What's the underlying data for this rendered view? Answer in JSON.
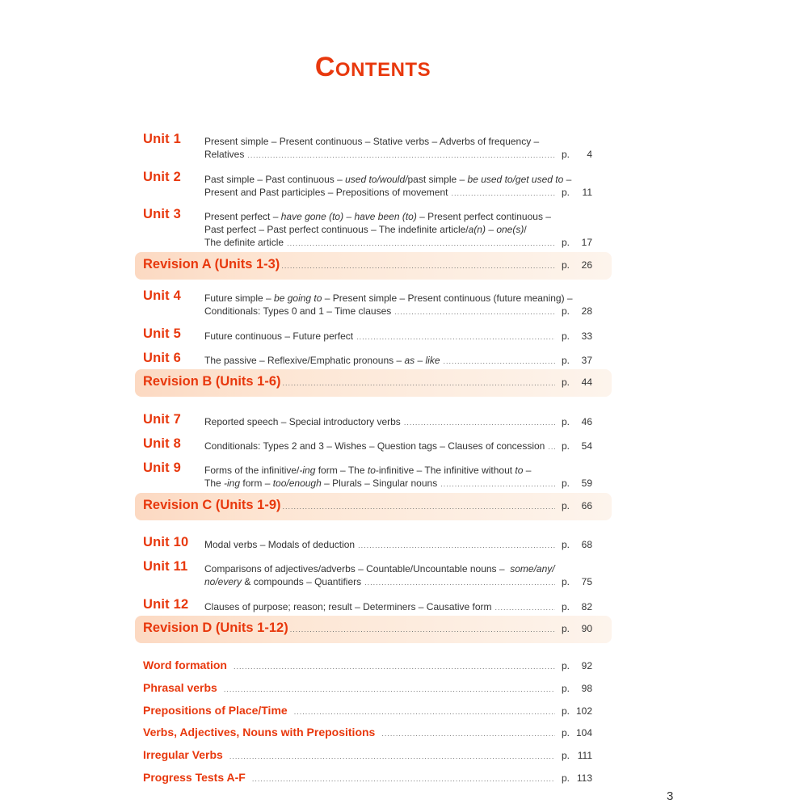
{
  "title": "Contents",
  "page_prefix": "p.",
  "units": [
    {
      "label": "Unit 1",
      "lines": [
        "Present simple – Present continuous – Stative verbs – Adverbs of frequency –",
        "Relatives"
      ],
      "page": "4"
    },
    {
      "label": "Unit 2",
      "lines_html": true,
      "lines": [
        "Past simple – Past continuous – <em>used to/would/</em>past simple – <em>be used to/get used to</em> –",
        "Present and Past participles – Prepositions of movement"
      ],
      "page": "11"
    },
    {
      "label": "Unit 3",
      "lines": [
        "Present perfect – <em>have gone (to) – have been (to)</em> – Present perfect continuous –",
        "Past perfect – Past perfect continuous – The indefinite article/<em>a(n) – one(s)</em>/",
        "The definite article"
      ],
      "page": "17"
    },
    {
      "label": "Unit 4",
      "lines": [
        "Future simple – <em>be going to</em> – Present simple – Present continuous (future meaning) –",
        "Conditionals: Types 0 and 1 – Time clauses"
      ],
      "page": "28"
    },
    {
      "label": "Unit 5",
      "lines": [
        "Future continuous – Future perfect"
      ],
      "page": "33"
    },
    {
      "label": "Unit 6",
      "lines": [
        "The passive – Reflexive/Emphatic pronouns – <em>as</em> – <em>like</em>"
      ],
      "page": "37"
    },
    {
      "label": "Unit 7",
      "lines": [
        "Reported speech – Special introductory verbs"
      ],
      "page": "46"
    },
    {
      "label": "Unit 8",
      "lines": [
        "Conditionals: Types 2 and 3 – Wishes – Question tags – Clauses of concession"
      ],
      "page": "54"
    },
    {
      "label": "Unit 9",
      "lines": [
        "Forms of the infinitive/<em>-ing</em> form – The <em>to</em>-infinitive – The infinitive without <em>to</em> –",
        "The <em>-ing</em> form – <em>too/enough</em> – Plurals – Singular nouns"
      ],
      "page": "59"
    },
    {
      "label": "Unit 10",
      "lines": [
        "Modal verbs – Modals of deduction"
      ],
      "page": "68"
    },
    {
      "label": "Unit 11",
      "lines": [
        "Comparisons of adjectives/adverbs – Countable/Uncountable nouns – &nbsp;<em>some/any/</em>",
        "<em>no/every</em> &amp; compounds – Quantifiers"
      ],
      "page": "75"
    },
    {
      "label": "Unit 12",
      "lines": [
        "Clauses of purpose; reason; result – Determiners – Causative form"
      ],
      "page": "82"
    }
  ],
  "revisions": [
    {
      "label": "Revision A (Units 1-3)",
      "page": "26"
    },
    {
      "label": "Revision B (Units 1-6)",
      "page": "44"
    },
    {
      "label": "Revision C (Units 1-9)",
      "page": "66"
    },
    {
      "label": "Revision D (Units 1-12)",
      "page": "90"
    }
  ],
  "extras": [
    {
      "label": "Word formation",
      "page": "92"
    },
    {
      "label": "Phrasal verbs",
      "page": "98"
    },
    {
      "label": "Prepositions of Place/Time",
      "page": "102"
    },
    {
      "label": "Verbs, Adjectives, Nouns with Prepositions",
      "page": "104"
    },
    {
      "label": "Irregular Verbs",
      "page": "111"
    },
    {
      "label": "Progress Tests A-F",
      "page": "113"
    }
  ],
  "page_number": "3",
  "colors": {
    "accent": "#e8380d",
    "band": "#fde3cf",
    "text": "#333333"
  }
}
